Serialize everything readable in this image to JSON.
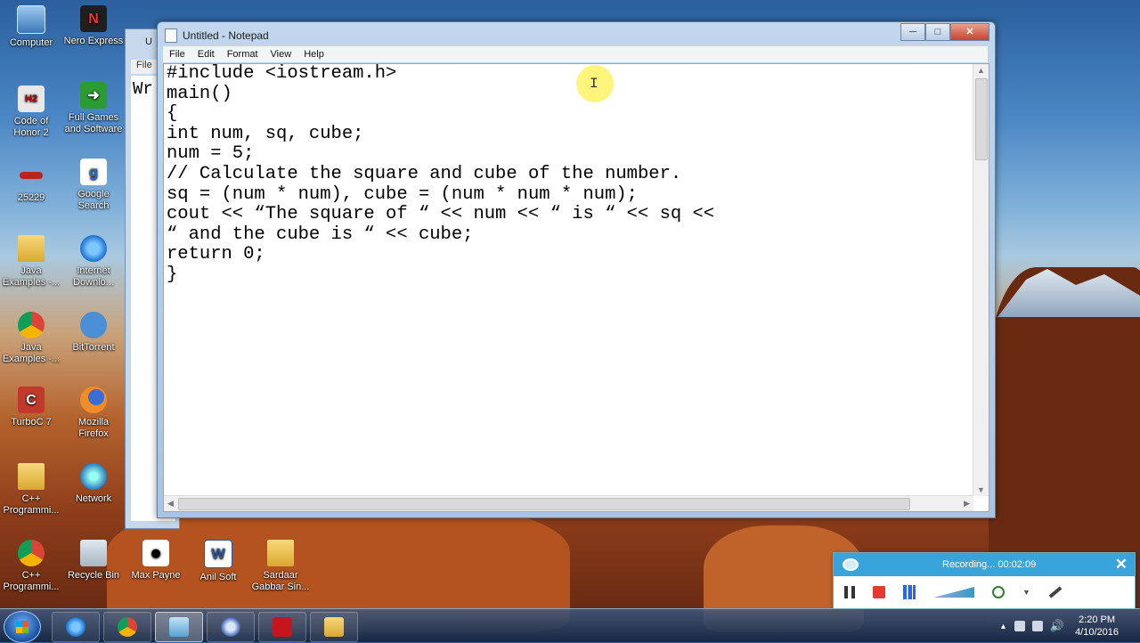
{
  "desktop": {
    "icons": [
      {
        "label": "Computer"
      },
      {
        "label": "Nero Express"
      },
      {
        "label": "Code of Honor 2"
      },
      {
        "label": "Full Games and Software"
      },
      {
        "label": "25229"
      },
      {
        "label": "Google Search"
      },
      {
        "label": "Java Examples -..."
      },
      {
        "label": "Internet Downlo..."
      },
      {
        "label": "Java Examples -..."
      },
      {
        "label": "BitTorrent"
      },
      {
        "label": "TurboC 7"
      },
      {
        "label": "Mozilla Firefox"
      },
      {
        "label": "C++ Programmi..."
      },
      {
        "label": "Network"
      },
      {
        "label": "C++ Programmi..."
      },
      {
        "label": "Recycle Bin"
      },
      {
        "label": "Max Payne"
      },
      {
        "label": "Anil Soft"
      },
      {
        "label": "Sardaar Gabbar Sin..."
      }
    ]
  },
  "back_window": {
    "title": "U",
    "menu_label": "File",
    "text": "Wr"
  },
  "notepad": {
    "title": "Untitled - Notepad",
    "menu": [
      "File",
      "Edit",
      "Format",
      "View",
      "Help"
    ],
    "code": "#include <iostream.h>\nmain()\n{\nint num, sq, cube;\nnum = 5;\n// Calculate the square and cube of the number.\nsq = (num * num), cube = (num * num * num);\ncout << “The square of “ << num << “ is “ << sq <<\n“ and the cube is “ << cube;\nreturn 0;\n}"
  },
  "recording": {
    "status": "Recording... 00:02:09"
  },
  "taskbar": {
    "clock_time": "2:20 PM",
    "clock_date": "4/10/2016"
  }
}
